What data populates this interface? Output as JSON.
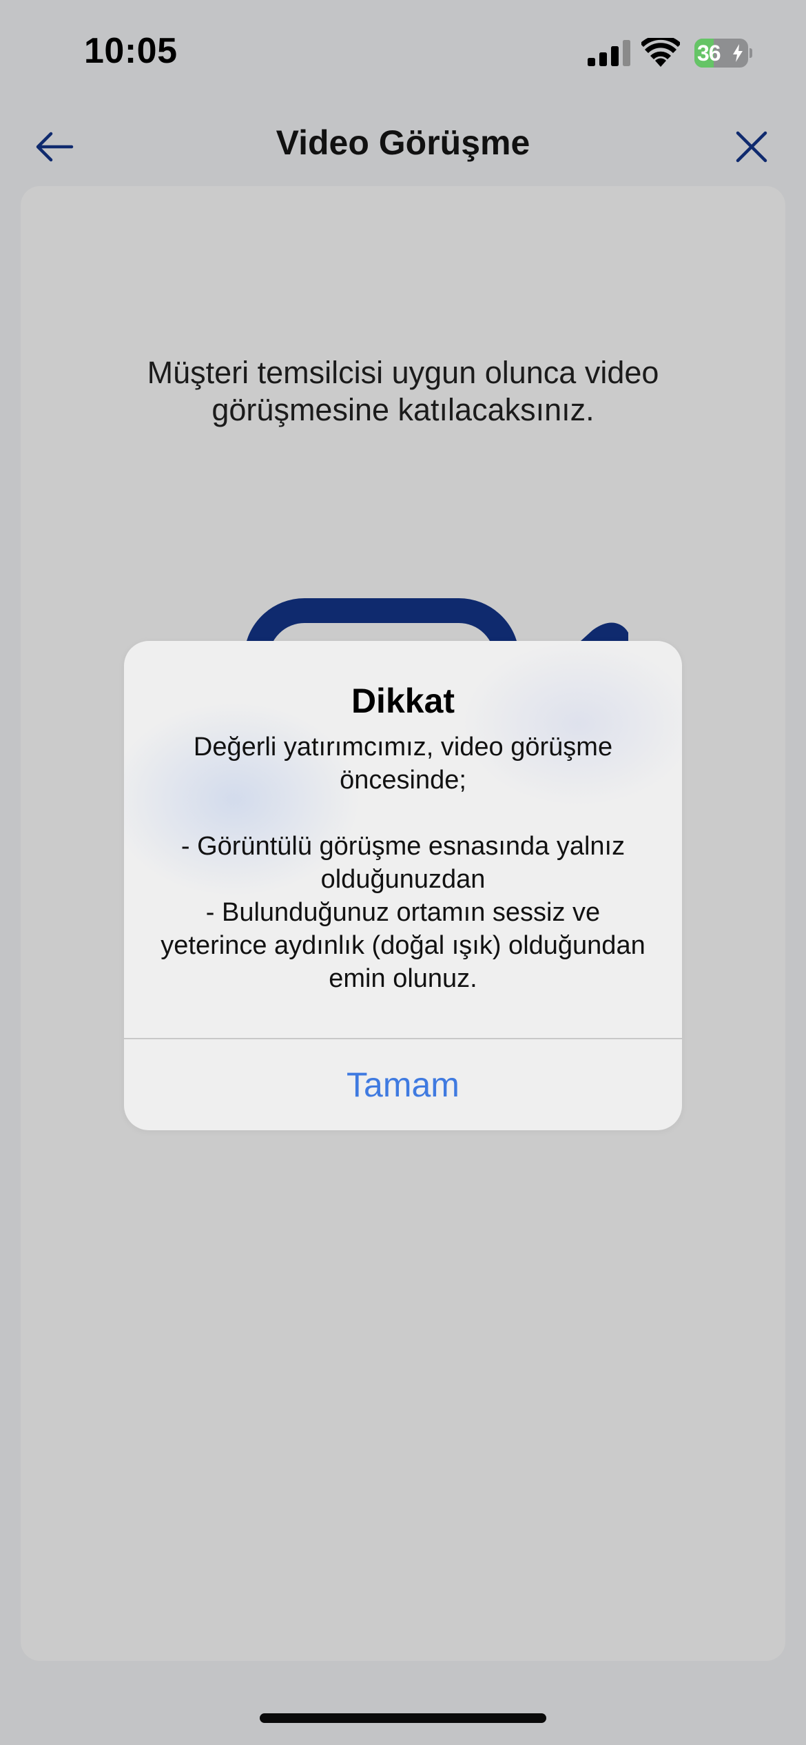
{
  "status_bar": {
    "time": "10:05",
    "signal_icon": "cellular-signal-icon",
    "wifi_icon": "wifi-icon",
    "battery_level": "36",
    "battery_fraction": 0.36,
    "battery_charging": true
  },
  "nav": {
    "title": "Video Görüşme",
    "back_icon": "arrow-left-icon",
    "close_icon": "close-icon"
  },
  "content": {
    "intro_text": "Müşteri temsilcisi uygun olunca video görüşmesine katılacaksınız.",
    "illustration_icon": "video-camera-icon"
  },
  "alert": {
    "title": "Dikkat",
    "message": "Değerli yatırımcımız, video görüşme öncesinde;\n\n- Görüntülü görüşme esnasında yalnız olduğunuzdan\n- Bulunduğunuz ortamın sessiz ve yeterince aydınlık (doğal ışık) olduğundan emin olunuz.",
    "action_label": "Tamam"
  },
  "colors": {
    "brand_navy": "#0f2a6e",
    "alert_action": "#3f7ae0",
    "battery_fill": "#65c466"
  }
}
